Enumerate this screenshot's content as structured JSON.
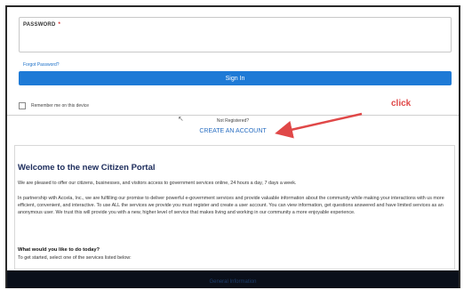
{
  "login": {
    "password_label": "PASSWORD",
    "required_marker": "*",
    "forgot_link": "Forgot Password?",
    "sign_in_button": "Sign In",
    "remember_label": "Remember me on this device"
  },
  "registration": {
    "prompt": "Not Registered?",
    "create_account_link": "CREATE AN ACCOUNT"
  },
  "annotation": {
    "label": "click",
    "color": "#e04848"
  },
  "portal": {
    "title": "Welcome to the new Citizen Portal",
    "intro": "We are pleased to offer our citizens, businesses, and visitors access to government services online, 24 hours a day, 7 days a week.",
    "paragraph": "In partnership with Accela, Inc., we are fulfilling our promise to deliver powerful e-government services and provide valuable information about the community while making your interactions with us more efficient, convenient, and interactive. To use ALL the services we provide you must register and create a user account. You can view information, get questions answered and have limited services as an anonymous user. We trust this will provide you with a new, higher level of service that makes living and working in our community a more enjoyable experience.",
    "question": "What would you like to do today?",
    "instruction": "To get started, select one of the services listed below:"
  },
  "footer": {
    "label": "General Information"
  },
  "colors": {
    "primary_button": "#1e7ad6",
    "link": "#2a6fc2",
    "title": "#1a2a5a",
    "footer_bg": "#0a0f1a"
  }
}
